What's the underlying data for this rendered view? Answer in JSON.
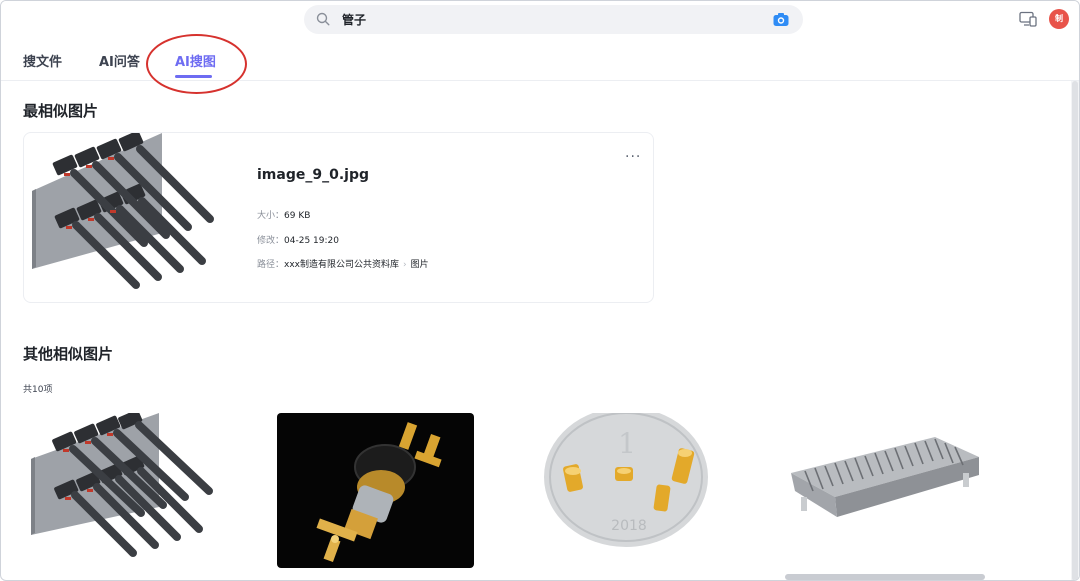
{
  "search": {
    "query": "管子"
  },
  "user": {
    "avatar_text": "制"
  },
  "tabs": [
    {
      "label": "搜文件"
    },
    {
      "label": "AI问答"
    },
    {
      "label": "AI搜图"
    }
  ],
  "best_match": {
    "section_title": "最相似图片",
    "file_name": "image_9_0.jpg",
    "more_label": "···",
    "size_key": "大小：",
    "size_value": "69 KB",
    "modified_key": "修改：",
    "modified_value": "04-25 19:20",
    "path_key": "路径：",
    "path_part1": "xxx制造有限公司公共资料库",
    "path_sep": "›",
    "path_part2": "图片"
  },
  "others": {
    "section_title": "其他相似图片",
    "count_label": "共10项",
    "items": [
      {
        "icon": "cable-connector-image"
      },
      {
        "icon": "coaxial-connector-image"
      },
      {
        "icon": "coin-connectors-image"
      },
      {
        "icon": "board-connector-image"
      }
    ]
  },
  "colors": {
    "accent": "#6e6cf2",
    "annotation_ring": "#d6322e",
    "avatar_bg": "#e8534a",
    "camera_icon": "#2f8cf5"
  }
}
